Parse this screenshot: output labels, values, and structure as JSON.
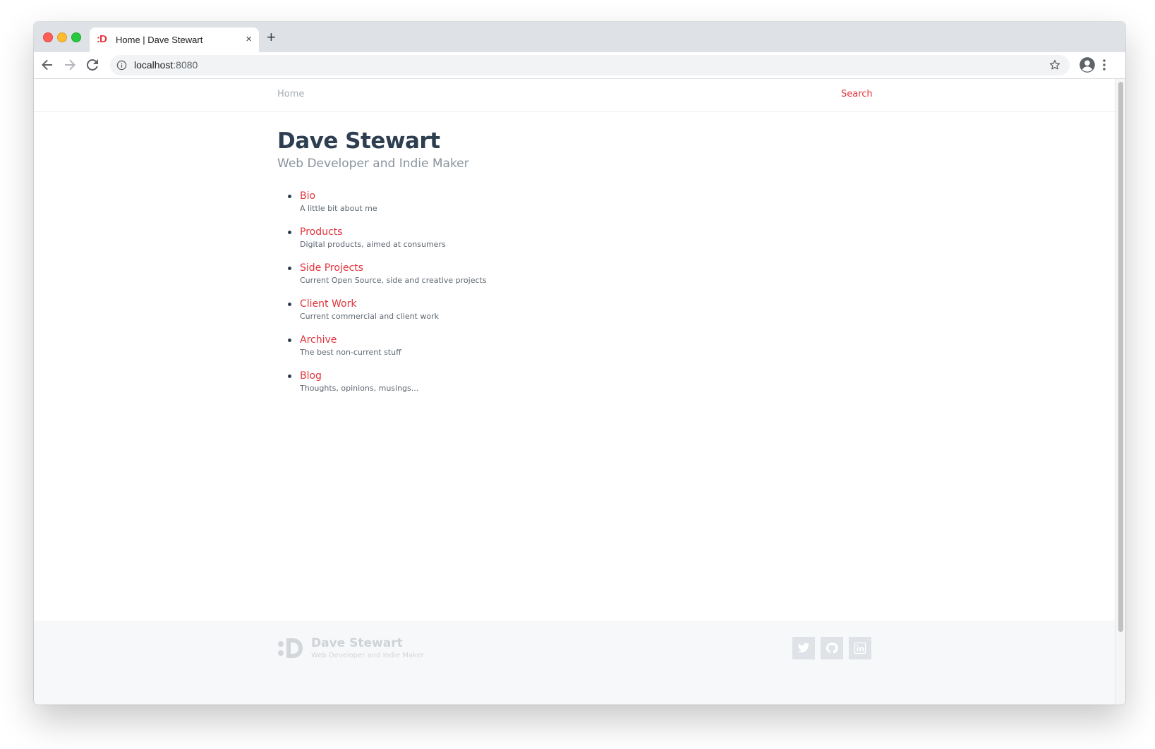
{
  "browser": {
    "tab_title": "Home | Dave Stewart",
    "tab_favicon": ":D",
    "tab_close": "×",
    "new_tab": "+",
    "url_host": "localhost",
    "url_port": ":8080"
  },
  "site": {
    "nav": {
      "home": "Home",
      "search": "Search"
    },
    "title": "Dave Stewart",
    "subtitle": "Web Developer and Indie Maker",
    "menu": [
      {
        "label": "Bio",
        "desc": "A little bit about me"
      },
      {
        "label": "Products",
        "desc": "Digital products, aimed at consumers"
      },
      {
        "label": "Side Projects",
        "desc": "Current Open Source, side and creative projects"
      },
      {
        "label": "Client Work",
        "desc": "Current commercial and client work"
      },
      {
        "label": "Archive",
        "desc": "The best non-current stuff"
      },
      {
        "label": "Blog",
        "desc": "Thoughts, opinions, musings..."
      }
    ],
    "footer": {
      "name": "Dave Stewart",
      "tagline": "Web Developer and Indie Maker",
      "social": [
        "twitter-icon",
        "github-icon",
        "linkedin-icon"
      ]
    }
  },
  "colors": {
    "accent": "#e3343c",
    "heading": "#2c3e50",
    "muted": "#8a939d",
    "footer_bg": "#f7f8f9"
  }
}
